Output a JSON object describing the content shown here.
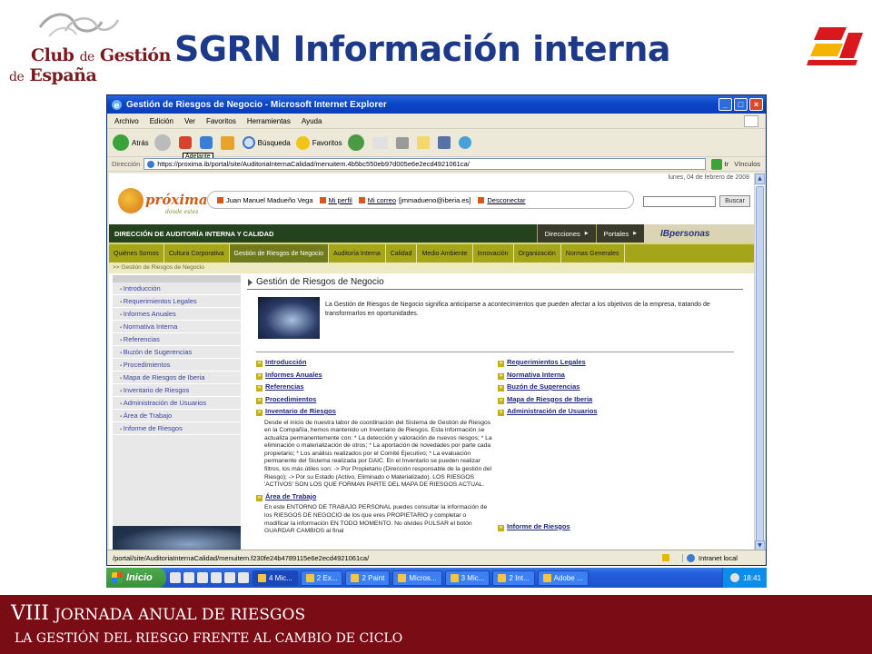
{
  "slide": {
    "logo": {
      "line1_main": "Club ",
      "line1_small": "de",
      "line1_end": " Gestión",
      "line2_main": "de Riesgos ",
      "line2_small": "de",
      "line2_end": " España"
    },
    "title": "SGRN Información interna",
    "footer": {
      "line1_main": "VIII",
      "line1_rest": "JORNADA ANUAL DE RIESGOS",
      "line2": "LA GESTIÓN DEL RIESGO FRENTE AL CAMBIO DE CICLO"
    }
  },
  "browser": {
    "window_title": "Gestión de Riesgos de Negocio - Microsoft Internet Explorer",
    "menu": [
      "Archivo",
      "Edición",
      "Ver",
      "Favoritos",
      "Herramientas",
      "Ayuda"
    ],
    "toolbar": {
      "back": "Atrás",
      "search": "Búsqueda",
      "favorites": "Favoritos",
      "tooltip": "Adelante"
    },
    "address": {
      "label": "Dirección",
      "url": "https://proxima.ib/portal/site/AuditoriaInternaCalidad/menuitem.4b5bc550eb97d005e6e2ecd4921061ca/",
      "go": "Ir",
      "links": "Vínculos"
    },
    "status": {
      "path": "/portal/site/AuditoriaInternaCalidad/menuitem.f230fe24b4789115e6e2ecd4921061ca/",
      "zone": "Intranet local"
    }
  },
  "page": {
    "date": "lunes, 04 de febrero de 2008",
    "brand": "próxima",
    "brand_tagline": "donde estes",
    "user_name": "Juan Manuel Madueño Vega",
    "my_profile": "Mi perfil",
    "my_mail": "Mi correo",
    "mail_address": "[jmmadueno@iberia.es]",
    "disconnect": "Desconectar",
    "search_button": "Buscar",
    "department": "DIRECCIÓN DE AUDITORÍA INTERNA Y CALIDAD",
    "top_menus": [
      "Direcciones",
      "Portales"
    ],
    "ibpersonas": "IBpersonas",
    "tabs": [
      "Quiénes Somos",
      "Cultura Corporativa",
      "Gestión de Riesgos de Negocio",
      "Auditoría Interna",
      "Calidad",
      "Medio Ambiente",
      "Innovación",
      "Organización",
      "Normas Generales"
    ],
    "active_tab_index": 2,
    "breadcrumb": ">> Gestión de Riesgos de Negocio",
    "sidebar": [
      "Introducción",
      "Requerimientos Legales",
      "Informes Anuales",
      "Normativa Interna",
      "Referencias",
      "Buzón de Sugerencias",
      "Procedimientos",
      "Mapa de Riesgos de Iberia",
      "Inventario de Riesgos",
      "Administración de Usuarios",
      "Área de Trabajo",
      "Informe de Riesgos"
    ],
    "main_title": "Gestión de Riesgos de Negocio",
    "intro": "La Gestión de Riesgos de Negocio significa anticiparse a acontecimientos que pueden afectar a los objetivos de la empresa, tratando de transformarlos en oportunidades.",
    "left_links": {
      "introduccion": "Introducción",
      "informes": "Informes Anuales",
      "referencias": "Referencias",
      "procedimientos": "Procedimientos",
      "inventario": "Inventario de Riesgos",
      "inventario_desc": "Desde el inicio de nuestra labor de coordinación del Sistema de Gestión de Riesgos en la Compañía, hemos mantenido un Inventario de Riesgos. Esta información se actualiza permanentemente con: * La detección y valoración de nuevos riesgos; * La eliminación o materialización de otros; * La aportación de novedades por parte cada propietario; * Los análisis realizados por el Comité Ejecutivo; * La evaluación permanente del Sistema realizada por DAIC. En el Inventario se pueden realizar filtros, los más útiles son: -> Por Propietario (Dirección responsable de la gestión del Riesgo); -> Por su Estado (Activo, Eliminado o Materializado). LOS RIESGOS 'ACTIVOS' SON LOS QUE FORMAN PARTE DEL MAPA DE RIESGOS ACTUAL.",
      "area": "Área de Trabajo",
      "area_desc": "En este ENTORNO DE TRABAJO PERSONAL puedes consultar la información de los RIESGOS DE NEGOCIO de los que eres PROPIETARIO y completar o modificar la información EN TODO MOMENTO. No olvides PULSAR el botón GUARDAR CAMBIOS al final"
    },
    "right_links": {
      "requerimientos": "Requerimientos Legales",
      "normativa": "Normativa Interna",
      "buzon": "Buzón de Sugerencias",
      "mapa": "Mapa de Riesgos de Iberia",
      "administracion": "Administración de Usuarios",
      "informe": "Informe de Riesgos"
    }
  },
  "taskbar": {
    "start": "Inicio",
    "buttons": [
      "4 Mic...",
      "2 Ex...",
      "2 Paint",
      "Micros...",
      "3 Mic...",
      "2 Int...",
      "Adobe ..."
    ],
    "active_button_index": 0,
    "clock": "18:41"
  },
  "colors": {
    "title_blue": "#1d3a8a",
    "footer_red": "#7a0c15",
    "logo_red": "#7a1a1e",
    "nav_olive": "#a5a519",
    "dark_bar": "#25421e"
  }
}
